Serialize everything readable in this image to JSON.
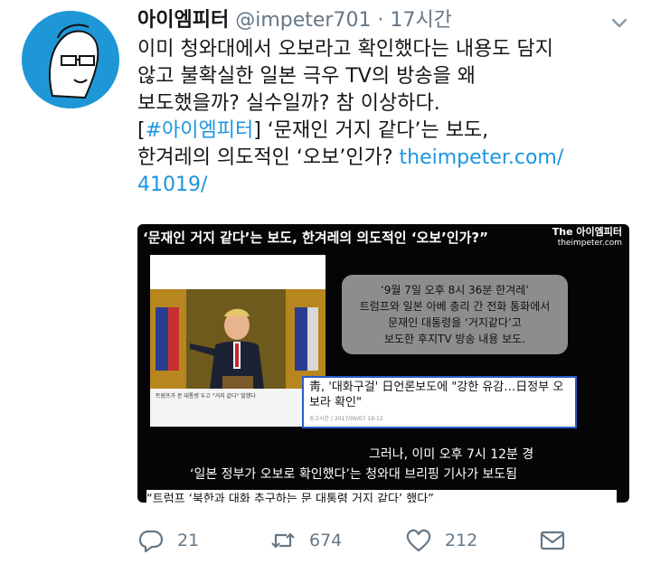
{
  "tweet": {
    "display_name": "아이엠피터",
    "handle": "@impeter701",
    "separator": "·",
    "time": "17시간",
    "lines": [
      "이미 청와대에서 오보라고 확인했다는 내용도 담지",
      "않고 불확실한 일본 극우 TV의 방송을 왜",
      "보도했을까? 실수일까? 참 이상하다."
    ],
    "bracket_open": "[",
    "hashtag": "#아이엠피터",
    "headline_part1": "] ‘문재인 거지 같다’는 보도,",
    "headline_part2": "한겨레의 의도적인 ‘오보’인가? ",
    "link_part1": "theimpeter.com/",
    "link_part2": "41019/"
  },
  "media": {
    "title": "‘문재인 거지 같다’는 보도, 한겨레의 의도적인 ‘오보’인가?”",
    "brand_line1": "The 아이엠피터",
    "brand_line2": "theimpeter.com",
    "gray_box_lines": [
      "‘9월 7일 오후 8시 36분 한겨레’",
      "트럼프와 일본 아베 총리 간 전화 통화에서",
      "문재인 대통령을 ‘거지같다’고",
      "보도한 후지TV 방송 내용 보도."
    ],
    "card_caption1": "트럼프가 문 대통령 두고 \"거지 같다\" 말했다",
    "news_headline": "靑, '대화구걸' 日언론보도에 \"강한 유감…日정부 오보라 확인\"",
    "news_date": "송고시간 | 2017/09/07 19:12",
    "text_line1": "그러나, 이미  오후 7시 12분 경",
    "text_line2": "‘일본 정부가 오보로  확인했다’는 청와대 브리핑 기사가 보도됨",
    "bottom_strip": "“트럼프 ‘북한과 대화 추구하는 문 대통령 거지 같다’ 했다”"
  },
  "actions": {
    "reply_count": "21",
    "retweet_count": "674",
    "like_count": "212"
  },
  "colors": {
    "link": "#1b95e0",
    "secondary_text": "#657786",
    "avatar_bg": "#1f97d6"
  },
  "icons": [
    "avatar",
    "chevron-down-icon",
    "reply-icon",
    "retweet-icon",
    "like-icon",
    "share-icon"
  ]
}
